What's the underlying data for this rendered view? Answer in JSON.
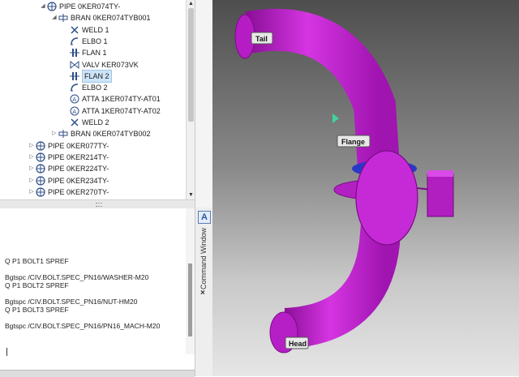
{
  "tree": {
    "items": [
      {
        "label": "PIPE 0KER074TY-",
        "type": "pipe",
        "expanded": true
      },
      {
        "label": "BRAN 0KER074TYB001",
        "type": "bran",
        "expanded": true
      },
      {
        "label": "WELD 1",
        "type": "weld"
      },
      {
        "label": "ELBO 1",
        "type": "elbo"
      },
      {
        "label": "FLAN 1",
        "type": "flan"
      },
      {
        "label": "VALV KER073VK",
        "type": "valv"
      },
      {
        "label": "FLAN 2",
        "type": "flan",
        "selected": true
      },
      {
        "label": "ELBO 2",
        "type": "elbo"
      },
      {
        "label": "ATTA 1KER074TY-AT01",
        "type": "atta"
      },
      {
        "label": "ATTA 1KER074TY-AT02",
        "type": "atta"
      },
      {
        "label": "WELD 2",
        "type": "weld"
      },
      {
        "label": "BRAN 0KER074TYB002",
        "type": "bran",
        "expanded": false
      },
      {
        "label": "PIPE 0KER077TY-",
        "type": "pipe",
        "expanded": false
      },
      {
        "label": "PIPE 0KER214TY-",
        "type": "pipe",
        "expanded": false
      },
      {
        "label": "PIPE 0KER224TY-",
        "type": "pipe",
        "expanded": false
      },
      {
        "label": "PIPE 0KER234TY-",
        "type": "pipe",
        "expanded": false
      },
      {
        "label": "PIPE 0KER270TY-",
        "type": "pipe",
        "expanded": false
      }
    ]
  },
  "command_window": {
    "title": "Command Window",
    "close_glyph": "×",
    "lines": [
      "Q P1 BOLT1 SPREF",
      "",
      "Bgtspc /CIV.BOLT.SPEC_PN16/WASHER-M20",
      "Q P1 BOLT2 SPREF",
      "",
      "Bgtspc /CIV.BOLT.SPEC_PN16/NUT-HM20",
      "Q P1 BOLT3 SPREF",
      "",
      "Bgtspc /CIV.BOLT.SPEC_PN16/PN16_MACH-M20"
    ]
  },
  "viewport": {
    "labels": {
      "tail": "Tail",
      "flange": "Flange",
      "head": "Head"
    },
    "pipe_color": "#c21cd1",
    "pipe_highlight": "#e04ce8",
    "flange_ring_color": "#2a38c8"
  },
  "icons": {
    "pipe": "pipe-icon",
    "bran": "branch-icon",
    "weld": "weld-icon",
    "elbo": "elbow-icon",
    "flan": "flange-icon",
    "valv": "valve-icon",
    "atta": "attachment-icon"
  }
}
